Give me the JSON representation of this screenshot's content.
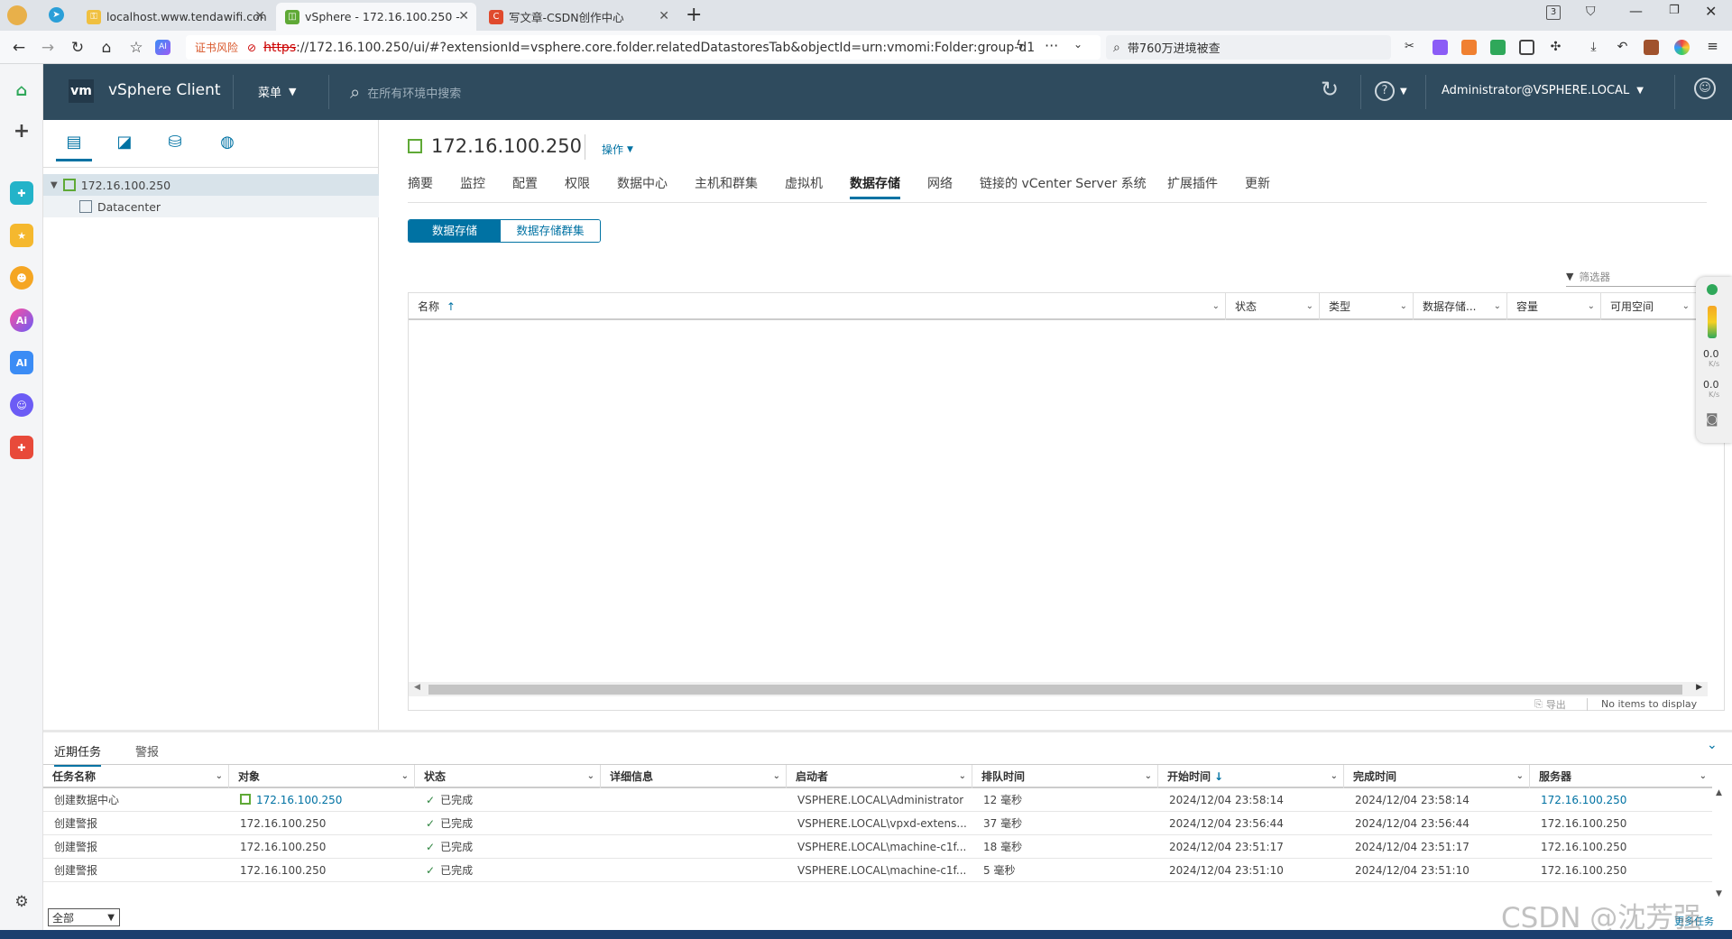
{
  "browser": {
    "tabs": [
      {
        "label": "localhost.www.tendawifi.con"
      },
      {
        "label": "vSphere - 172.16.100.250 -"
      },
      {
        "label": "写文章-CSDN创作中心"
      }
    ],
    "tab_count_badge": "3",
    "cert_warning": "证书风险",
    "url_scheme": "https",
    "url_rest": "://172.16.100.250/ui/#?extensionId=vsphere.core.folder.relatedDatastoresTab&objectId=urn:vmomi:Folder:group-d1",
    "search_text": "带760万进境被查"
  },
  "vsphere": {
    "logo": "vm",
    "product": "vSphere Client",
    "menu_label": "菜单",
    "global_search_placeholder": "在所有环境中搜索",
    "help_label": "?",
    "user": "Administrator@VSPHERE.LOCAL"
  },
  "nav_tree": {
    "root": "172.16.100.250",
    "child": "Datacenter"
  },
  "object": {
    "title": "172.16.100.250",
    "actions_label": "操作"
  },
  "object_tabs": [
    "摘要",
    "监控",
    "配置",
    "权限",
    "数据中心",
    "主机和群集",
    "虚拟机",
    "数据存储",
    "网络",
    "链接的 vCenter Server 系统",
    "扩展插件",
    "更新"
  ],
  "sub_toggle": {
    "left": "数据存储",
    "right": "数据存储群集"
  },
  "grid": {
    "filter_placeholder": "筛选器",
    "columns": [
      "名称",
      "状态",
      "类型",
      "数据存储...",
      "容量",
      "可用空间"
    ],
    "export_label": "导出",
    "empty_text": "No items to display"
  },
  "net_widget": {
    "up_value": "0.0",
    "up_unit": "K/s",
    "down_value": "0.0",
    "down_unit": "K/s"
  },
  "tasks": {
    "tabs": [
      "近期任务",
      "警报"
    ],
    "columns": [
      "任务名称",
      "对象",
      "状态",
      "详细信息",
      "启动者",
      "排队时间",
      "开始时间",
      "完成时间",
      "服务器"
    ],
    "rows": [
      {
        "name": "创建数据中心",
        "object": "172.16.100.250",
        "status": "已完成",
        "details": "",
        "initiator": "VSPHERE.LOCAL\\Administrator",
        "queued": "12 毫秒",
        "start": "2024/12/04 23:58:14",
        "finish": "2024/12/04 23:58:14",
        "server": "172.16.100.250"
      },
      {
        "name": "创建警报",
        "object": "172.16.100.250",
        "status": "已完成",
        "details": "",
        "initiator": "VSPHERE.LOCAL\\vpxd-extens...",
        "queued": "37 毫秒",
        "start": "2024/12/04 23:56:44",
        "finish": "2024/12/04 23:56:44",
        "server": "172.16.100.250"
      },
      {
        "name": "创建警报",
        "object": "172.16.100.250",
        "status": "已完成",
        "details": "",
        "initiator": "VSPHERE.LOCAL\\machine-c1f...",
        "queued": "18 毫秒",
        "start": "2024/12/04 23:51:17",
        "finish": "2024/12/04 23:51:17",
        "server": "172.16.100.250"
      },
      {
        "name": "创建警报",
        "object": "172.16.100.250",
        "status": "已完成",
        "details": "",
        "initiator": "VSPHERE.LOCAL\\machine-c1f...",
        "queued": "5 毫秒",
        "start": "2024/12/04 23:51:10",
        "finish": "2024/12/04 23:51:10",
        "server": "172.16.100.250"
      }
    ],
    "filter_value": "全部",
    "more_tasks": "更多任务"
  },
  "watermark": "CSDN @沈芳强"
}
